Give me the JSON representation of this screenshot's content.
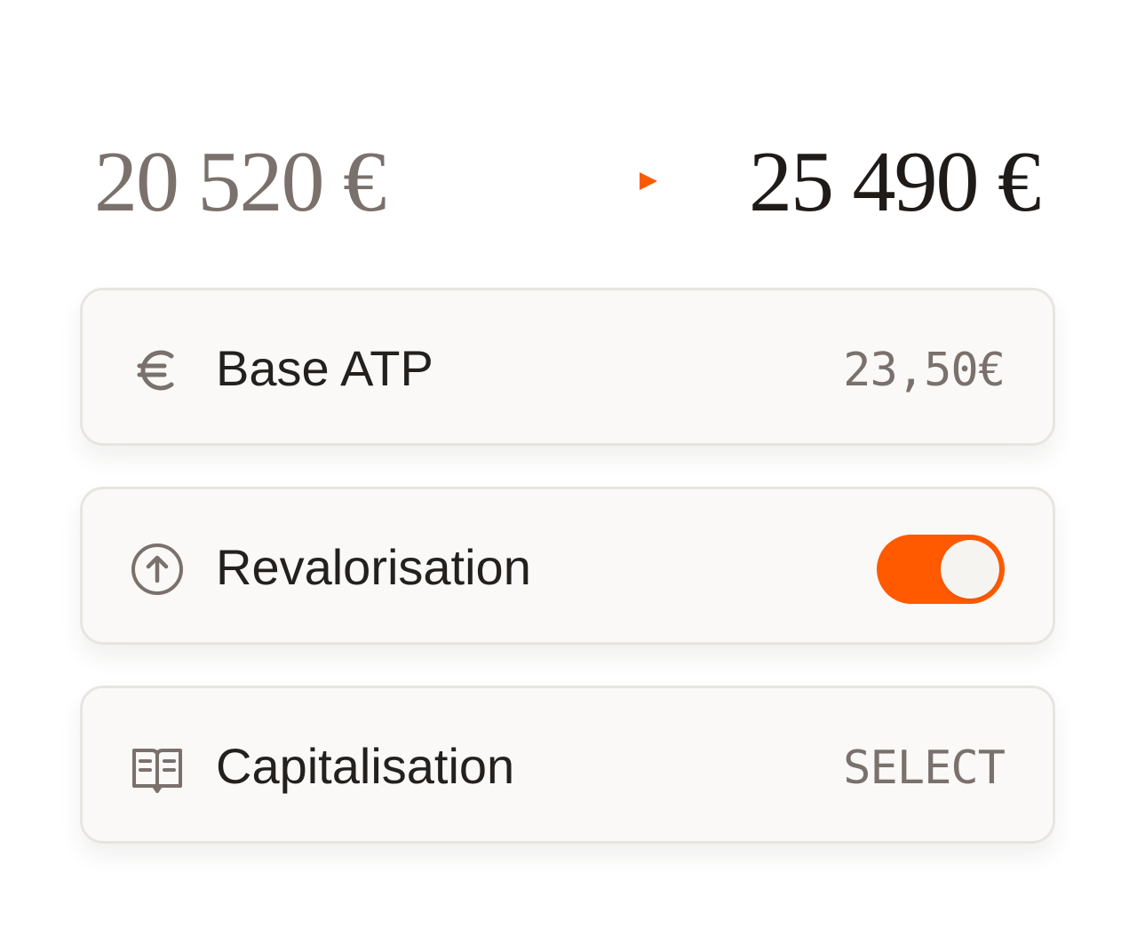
{
  "summary": {
    "amount_before": "20 520 €",
    "amount_after": "25 490 €",
    "arrow_icon": "arrow-right-icon"
  },
  "settings": [
    {
      "label": "Base ATP",
      "icon": "euro-icon",
      "value": "23,50€"
    },
    {
      "label": "Revalorisation",
      "icon": "arrow-up-circle-icon",
      "toggle_on": true
    },
    {
      "label": "Capitalisation",
      "icon": "open-book-icon",
      "action": "SELECT"
    }
  ],
  "colors": {
    "accent": "#ff5a00",
    "muted_text": "#7a716c",
    "primary_text": "#24201e",
    "card_background": "#faf9f7",
    "card_border": "#e7e5e0"
  }
}
